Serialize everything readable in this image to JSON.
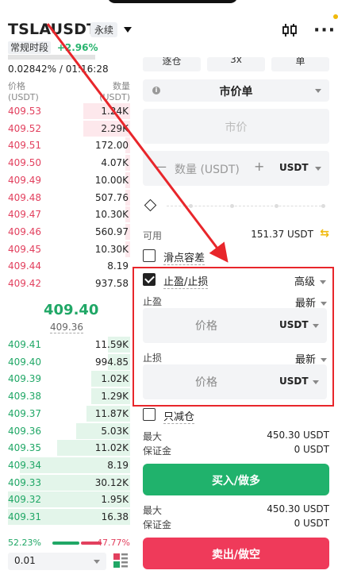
{
  "header": {
    "symbol": "TSLAUSDT",
    "contract_type": "永续",
    "session": "常规时段",
    "change": "+2.96%",
    "funding": "0.02842% / 01:16:28"
  },
  "orderbook": {
    "price_header": "价格",
    "price_unit": "(USDT)",
    "qty_header": "数量",
    "qty_unit": "(USDT)",
    "asks": [
      {
        "price": "409.53",
        "qty": "1.24K",
        "depth": 0.38
      },
      {
        "price": "409.52",
        "qty": "2.29K",
        "depth": 0.38
      },
      {
        "price": "409.51",
        "qty": "172.00",
        "depth": 0.04
      },
      {
        "price": "409.50",
        "qty": "4.07K",
        "depth": 0.04
      },
      {
        "price": "409.49",
        "qon": "",
        "qty": "10.00K",
        "depth": 0.04
      },
      {
        "price": "409.48",
        "qty": "507.76",
        "depth": 0.04
      },
      {
        "price": "409.47",
        "qty": "10.30K",
        "depth": 0.04
      },
      {
        "price": "409.46",
        "qty": "560.97",
        "depth": 0.04
      },
      {
        "price": "409.45",
        "qty": "10.30K",
        "depth": 0.04
      },
      {
        "price": "409.44",
        "qty": "8.19",
        "depth": 0.0
      },
      {
        "price": "409.42",
        "qty": "937.58",
        "depth": 0.0
      }
    ],
    "mid_price": "409.40",
    "mark_price": "409.36",
    "bids": [
      {
        "price": "409.41",
        "qty": "11.59K",
        "depth": 0.18
      },
      {
        "price": "409.40",
        "qty": "994.85",
        "depth": 0.18
      },
      {
        "price": "409.39",
        "qty": "1.02K",
        "depth": 0.32
      },
      {
        "price": "409.38",
        "qty": "1.29K",
        "depth": 0.32
      },
      {
        "price": "409.37",
        "qty": "11.87K",
        "depth": 0.36
      },
      {
        "price": "409.36",
        "qty": "5.03K",
        "depth": 0.44
      },
      {
        "price": "409.35",
        "qty": "11.02K",
        "depth": 0.6
      },
      {
        "price": "409.34",
        "qty": "8.19",
        "depth": 0.9
      },
      {
        "price": "409.33",
        "qty": "30.12K",
        "depth": 0.9
      },
      {
        "price": "409.32",
        "qty": "1.95K",
        "depth": 1.0
      },
      {
        "price": "409.31",
        "qty": "16.38",
        "depth": 1.0
      }
    ],
    "buy_ratio": "52.23%",
    "sell_ratio": "47.77%",
    "precision": "0.01"
  },
  "form": {
    "margin_mode": "逐仓",
    "leverage": "3x",
    "position_mode": "单",
    "order_type": "市价单",
    "price_placeholder": "市价",
    "qty_placeholder": "数量 (USDT)",
    "qty_unit": "USDT",
    "available_label": "可用",
    "available_value": "151.37 USDT",
    "slippage_label": "滑点容差",
    "tpsl_label": "止盈/止损",
    "tpsl_mode": "高级",
    "tp_label": "止盈",
    "tp_trigger": "最新",
    "tp_placeholder": "价格",
    "tp_unit": "USDT",
    "sl_label": "止损",
    "sl_trigger": "最新",
    "sl_placeholder": "价格",
    "sl_unit": "USDT",
    "reduce_only_label": "只减仓",
    "buy_max_label": "最大",
    "buy_max_value": "450.30 USDT",
    "buy_margin_label": "保证金",
    "buy_margin_value": "0 USDT",
    "buy_button": "买入/做多",
    "sell_max_label": "最大",
    "sell_max_value": "450.30 USDT",
    "sell_margin_label": "保证金",
    "sell_margin_value": "0 USDT",
    "sell_button": "卖出/做空"
  },
  "colors": {
    "buy": "#20b26c",
    "sell": "#ef3a5a",
    "highlight": "#e8262b",
    "accent": "#f0b90b"
  }
}
